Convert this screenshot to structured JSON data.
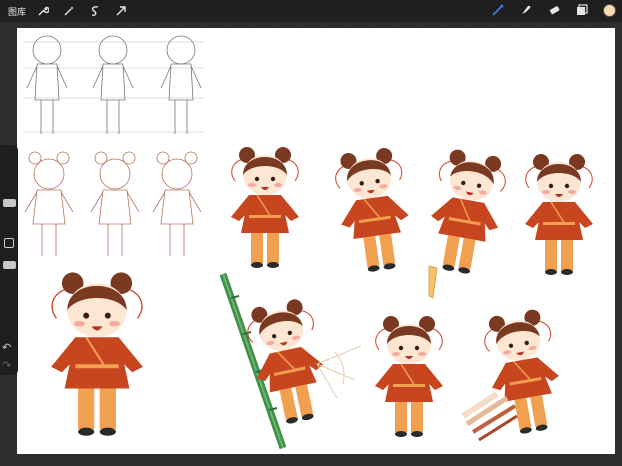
{
  "toolbar": {
    "gallery_label": "图库",
    "left_tools": [
      "wrench-icon",
      "magic-wand-icon",
      "selection-icon",
      "transform-arrow-icon"
    ],
    "right_tools": [
      "brush-icon",
      "smudge-icon",
      "eraser-icon",
      "layers-icon"
    ],
    "active_tool": "brush-icon",
    "accent_color": "#3d7be6",
    "current_color": "#f8dab4"
  },
  "sidebar": {
    "size_slider_value": 0.25,
    "opacity_slider_value": 0.6,
    "undo_icon": "undo-icon",
    "redo_icon": "redo-icon"
  },
  "artwork": {
    "background": "#ffffff",
    "robe_color": "#c8461f",
    "pants_color": "#f0a04f",
    "hair_color": "#7a3a22",
    "skin_color": "#fde6d2"
  }
}
